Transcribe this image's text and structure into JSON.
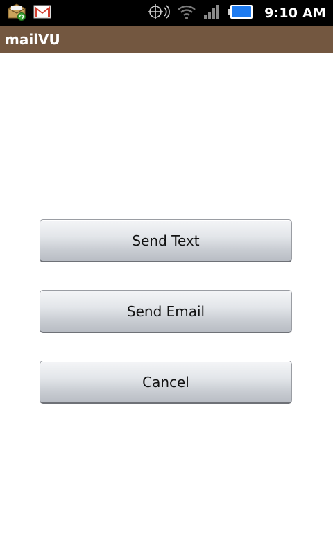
{
  "status_bar": {
    "time": "9:10 AM",
    "icons": [
      "mail-sync-icon",
      "gmail-icon",
      "gps-icon",
      "wifi-icon",
      "signal-icon",
      "battery-icon"
    ]
  },
  "app": {
    "title": "mailVU"
  },
  "buttons": {
    "send_text": "Send Text",
    "send_email": "Send Email",
    "cancel": "Cancel"
  },
  "colors": {
    "title_bar": "#735740",
    "status_bar": "#000000",
    "battery": "#1e90ff"
  }
}
